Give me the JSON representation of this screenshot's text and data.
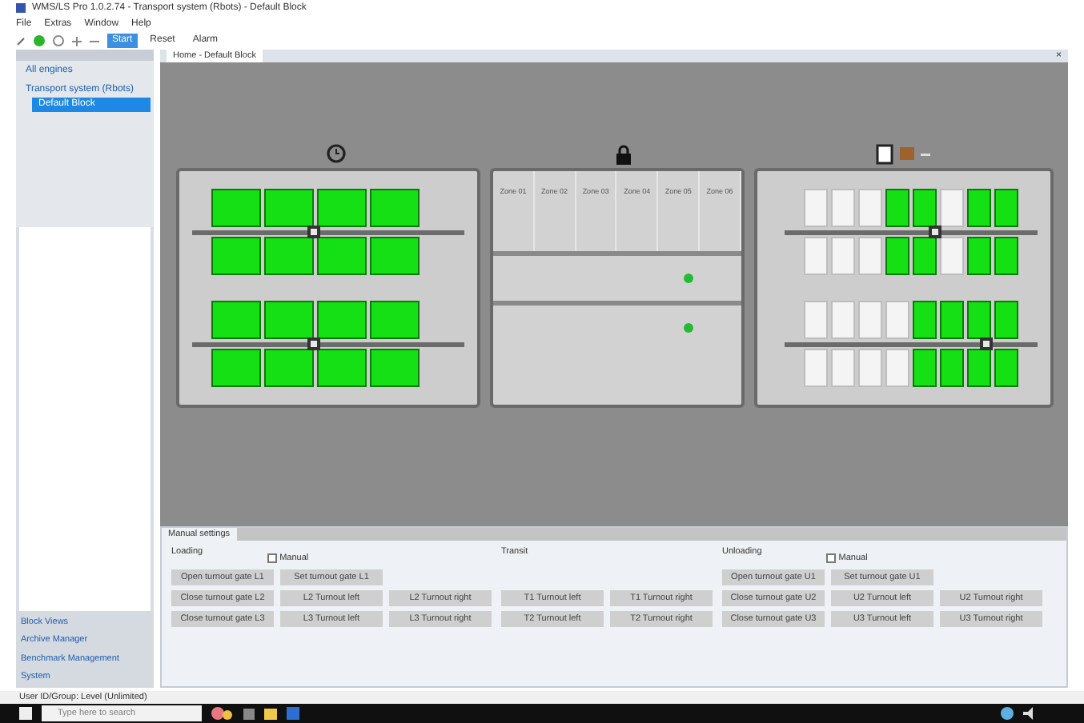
{
  "window": {
    "title": "WMS/LS Pro 1.0.2.74 - Transport system (Rbots) - Default Block"
  },
  "menu": [
    "File",
    "Extras",
    "Window",
    "Help"
  ],
  "toolbar": [
    {
      "label": "Start",
      "selected": true
    },
    {
      "label": "Reset",
      "selected": false
    },
    {
      "label": "Alarm",
      "selected": false
    }
  ],
  "sidebar": {
    "items": [
      {
        "label": "All engines",
        "selected": false
      },
      {
        "label": "Transport system (Rbots)",
        "selected": false,
        "children": [
          {
            "label": "Default Block",
            "selected": true
          }
        ]
      }
    ],
    "bottom_links": [
      "Block Views",
      "Archive Manager",
      "Benchmark Management",
      "System"
    ]
  },
  "document_tab": {
    "label": "Home - Default Block",
    "close": "×"
  },
  "canvas": {
    "left_module": {
      "racks": [
        {
          "rows": [
            [
              true,
              true,
              true,
              true
            ],
            [
              true,
              true,
              true,
              true
            ]
          ],
          "level": 0.45
        },
        {
          "rows": [
            [
              true,
              true,
              true,
              true
            ],
            [
              true,
              true,
              true,
              true
            ]
          ],
          "level": 0.45
        }
      ]
    },
    "middle_module": {
      "zones": [
        "Zone 01",
        "Zone 02",
        "Zone 03",
        "Zone 04",
        "Zone 05",
        "Zone 06"
      ],
      "lanes": [
        {
          "active": true
        },
        {
          "active": true
        }
      ]
    },
    "right_module": {
      "racks": [
        {
          "rows": [
            [
              false,
              false,
              false,
              true,
              true,
              false,
              true,
              true
            ],
            [
              false,
              false,
              false,
              true,
              true,
              false,
              true,
              true
            ]
          ],
          "level": 0.6
        },
        {
          "rows": [
            [
              false,
              false,
              false,
              false,
              true,
              true,
              true,
              true
            ],
            [
              false,
              false,
              false,
              false,
              true,
              true,
              true,
              true
            ]
          ],
          "level": 0.8
        }
      ]
    }
  },
  "bottom_panel": {
    "tab": "Manual settings",
    "groups": [
      {
        "title": "Loading",
        "manual": {
          "label": "Manual",
          "checked": false
        },
        "rows": [
          [
            "Open turnout gate L1",
            "Set turnout gate L1"
          ],
          [
            "Close turnout gate L2",
            "L2 Turnout left",
            "L2 Turnout right"
          ],
          [
            "Close turnout gate L3",
            "L3 Turnout left",
            "L3 Turnout right"
          ]
        ]
      },
      {
        "title": "Transit",
        "rows": [
          [],
          [
            "T1 Turnout left",
            "T1 Turnout right"
          ],
          [
            "T2 Turnout left",
            "T2 Turnout right"
          ]
        ]
      },
      {
        "title": "Unloading",
        "manual": {
          "label": "Manual",
          "checked": false
        },
        "rows": [
          [
            "Open turnout gate U1",
            "Set turnout gate U1"
          ],
          [
            "Close turnout gate U2",
            "U2 Turnout left",
            "U2 Turnout right"
          ],
          [
            "Close turnout gate U3",
            "U3 Turnout left",
            "U3 Turnout right"
          ]
        ]
      }
    ]
  },
  "status_bar": "User ID/Group: Level (Unlimited)",
  "taskbar": {
    "search": {
      "placeholder": "Type here to search"
    }
  }
}
